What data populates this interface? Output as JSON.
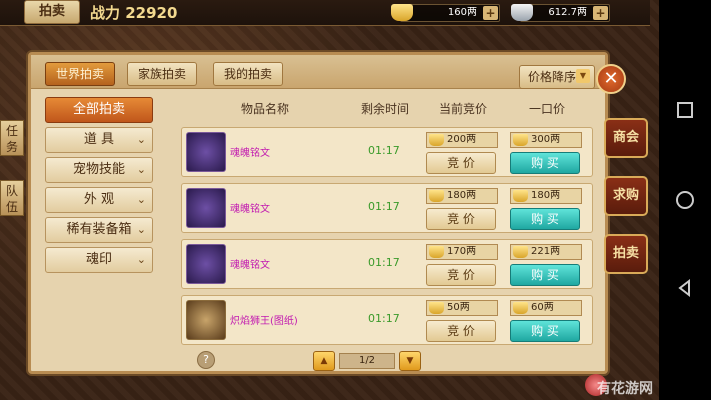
{
  "topbar": {
    "title": "拍卖",
    "power_label": "战力",
    "power_value": "22920",
    "gold": "160两",
    "silver": "612.7两",
    "plus": "+"
  },
  "tabs": [
    {
      "label": "世界拍卖",
      "active": true
    },
    {
      "label": "家族拍卖",
      "active": false
    },
    {
      "label": "我的拍卖",
      "active": false
    }
  ],
  "sort_label": "价格降序",
  "close_label": "✕",
  "sidebar": [
    {
      "label": "全部拍卖",
      "active": true,
      "chev": ""
    },
    {
      "label": "道    具",
      "active": false,
      "chev": "⌄"
    },
    {
      "label": "宠物技能",
      "active": false,
      "chev": "⌄"
    },
    {
      "label": "外    观",
      "active": false,
      "chev": "⌄"
    },
    {
      "label": "稀有装备箱",
      "active": false,
      "chev": "⌄"
    },
    {
      "label": "魂印",
      "active": false,
      "chev": "⌄"
    }
  ],
  "table": {
    "headers": [
      "物品名称",
      "剩余时间",
      "当前竞价",
      "一口价"
    ],
    "rows": [
      {
        "name": "魂魄铭文",
        "time": "01:17",
        "bid_price": "200两",
        "buy_price": "300两",
        "icon": "purple-rune",
        "bid_label": "竞 价",
        "buy_label": "购 买"
      },
      {
        "name": "魂魄铭文",
        "time": "01:17",
        "bid_price": "180两",
        "buy_price": "180两",
        "icon": "purple-rune",
        "bid_label": "竞 价",
        "buy_label": "购 买"
      },
      {
        "name": "魂魄铭文",
        "time": "01:17",
        "bid_price": "170两",
        "buy_price": "221两",
        "icon": "purple-rune",
        "bid_label": "竞 价",
        "buy_label": "购 买"
      },
      {
        "name": "炽焰狮王(图纸)",
        "time": "01:17",
        "bid_price": "50两",
        "buy_price": "60两",
        "icon": "lion-head",
        "bid_label": "竞 价",
        "buy_label": "购 买"
      }
    ]
  },
  "pager": {
    "page": "1/2",
    "prev": "▲",
    "next": "▼"
  },
  "help_label": "?",
  "right_menu": [
    "商会",
    "求购",
    "拍卖"
  ],
  "left_menu": [
    "任务",
    "队伍"
  ],
  "watermark": "有花游网"
}
